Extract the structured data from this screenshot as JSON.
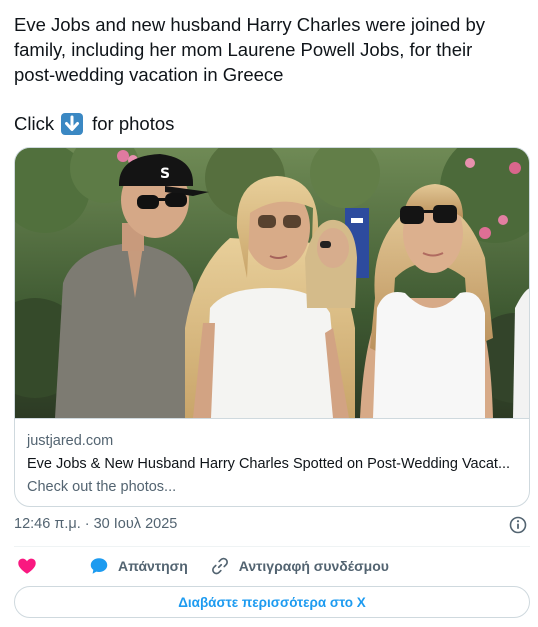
{
  "tweet": {
    "text_lines": [
      "Eve Jobs and new husband Harry Charles were joined by",
      "family, including her mom Laurene Powell Jobs, for their",
      "post-wedding vacation in Greece"
    ],
    "click_prefix": "Click",
    "click_emoji": "down-arrow-emoji",
    "click_suffix": "for photos"
  },
  "card": {
    "domain": "justjared.com",
    "title": "Eve Jobs & New Husband Harry Charles Spotted on Post-Wedding Vacat...",
    "description": "Check out the photos..."
  },
  "timestamp": "12:46 π.μ. · 30 Ιουλ 2025",
  "actions": {
    "like_icon": "heart-icon",
    "reply_label": "Απάντηση",
    "copy_link_label": "Αντιγραφή συνδέσμου"
  },
  "read_more_label": "Διαβάστε περισσότερα στο X",
  "colors": {
    "like": "#f91880",
    "reply_bubble": "#1d9bf0",
    "link": "#1d9bf0",
    "muted": "#536471",
    "border": "#cfd9de"
  }
}
